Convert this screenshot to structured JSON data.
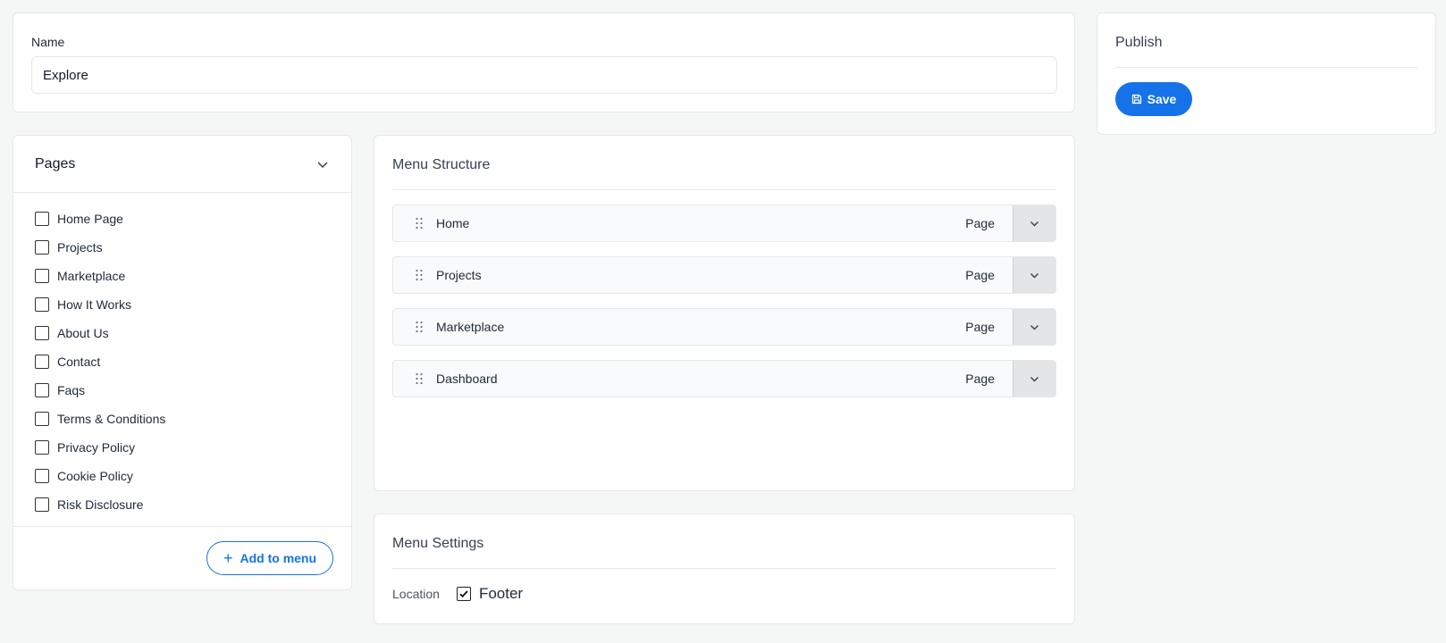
{
  "name_card": {
    "label": "Name",
    "value": "Explore"
  },
  "publish": {
    "title": "Publish",
    "save_label": "Save",
    "save_icon": "floppy-disk-icon",
    "accent_color": "#1572e8"
  },
  "pages": {
    "title": "Pages",
    "collapse_icon": "chevron-down-icon",
    "items": [
      {
        "label": "Home Page",
        "checked": false
      },
      {
        "label": "Projects",
        "checked": false
      },
      {
        "label": "Marketplace",
        "checked": false
      },
      {
        "label": "How It Works",
        "checked": false
      },
      {
        "label": "About Us",
        "checked": false
      },
      {
        "label": "Contact",
        "checked": false
      },
      {
        "label": "Faqs",
        "checked": false
      },
      {
        "label": "Terms & Conditions",
        "checked": false
      },
      {
        "label": "Privacy Policy",
        "checked": false
      },
      {
        "label": "Cookie Policy",
        "checked": false
      },
      {
        "label": "Risk Disclosure",
        "checked": false
      }
    ],
    "add_label": "Add to menu",
    "add_icon": "plus-icon"
  },
  "structure": {
    "title": "Menu Structure",
    "items": [
      {
        "label": "Home",
        "type": "Page"
      },
      {
        "label": "Projects",
        "type": "Page"
      },
      {
        "label": "Marketplace",
        "type": "Page"
      },
      {
        "label": "Dashboard",
        "type": "Page"
      }
    ]
  },
  "settings": {
    "title": "Menu Settings",
    "location_label": "Location",
    "option_label": "Footer",
    "option_checked": true
  }
}
